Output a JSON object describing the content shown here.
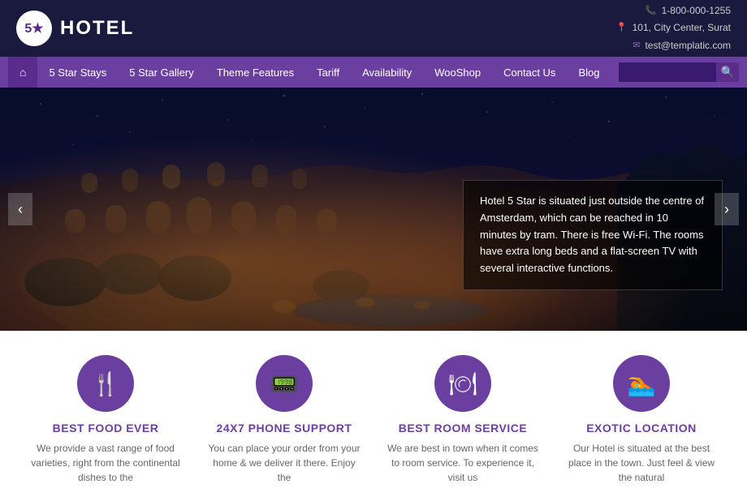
{
  "header": {
    "logo_number": "5★",
    "logo_text": "HOTEL",
    "phone": "1-800-000-1255",
    "address": "101, City Center, Surat",
    "email": "test@templatic.com"
  },
  "navbar": {
    "home_icon": "⌂",
    "items": [
      {
        "label": "5 Star Stays"
      },
      {
        "label": "5 Star Gallery"
      },
      {
        "label": "Theme Features"
      },
      {
        "label": "Tariff"
      },
      {
        "label": "Availability"
      },
      {
        "label": "WooShop"
      },
      {
        "label": "Contact Us"
      },
      {
        "label": "Blog"
      }
    ],
    "search_placeholder": ""
  },
  "hero": {
    "description": "Hotel 5 Star is situated just outside the centre of Amsterdam, which can be reached in 10 minutes by tram. There is free Wi-Fi. The rooms have extra long beds and a flat-screen TV with several interactive functions.",
    "arrow_left": "‹",
    "arrow_right": "›"
  },
  "features": [
    {
      "icon": "🍴",
      "title": "Best Food Ever",
      "description": "We provide a vast range of food varieties, right from the continental dishes to the"
    },
    {
      "icon": "📱",
      "title": "24X7 Phone Support",
      "description": "You can place your order from your home & we deliver it there. Enjoy the"
    },
    {
      "icon": "🍽",
      "title": "Best Room Service",
      "description": "We are best in town when it comes to room service. To experience it, visit us"
    },
    {
      "icon": "🏊",
      "title": "Exotic Location",
      "description": "Our Hotel is situated at the best place in the town. Just feel & view the natural"
    }
  ]
}
